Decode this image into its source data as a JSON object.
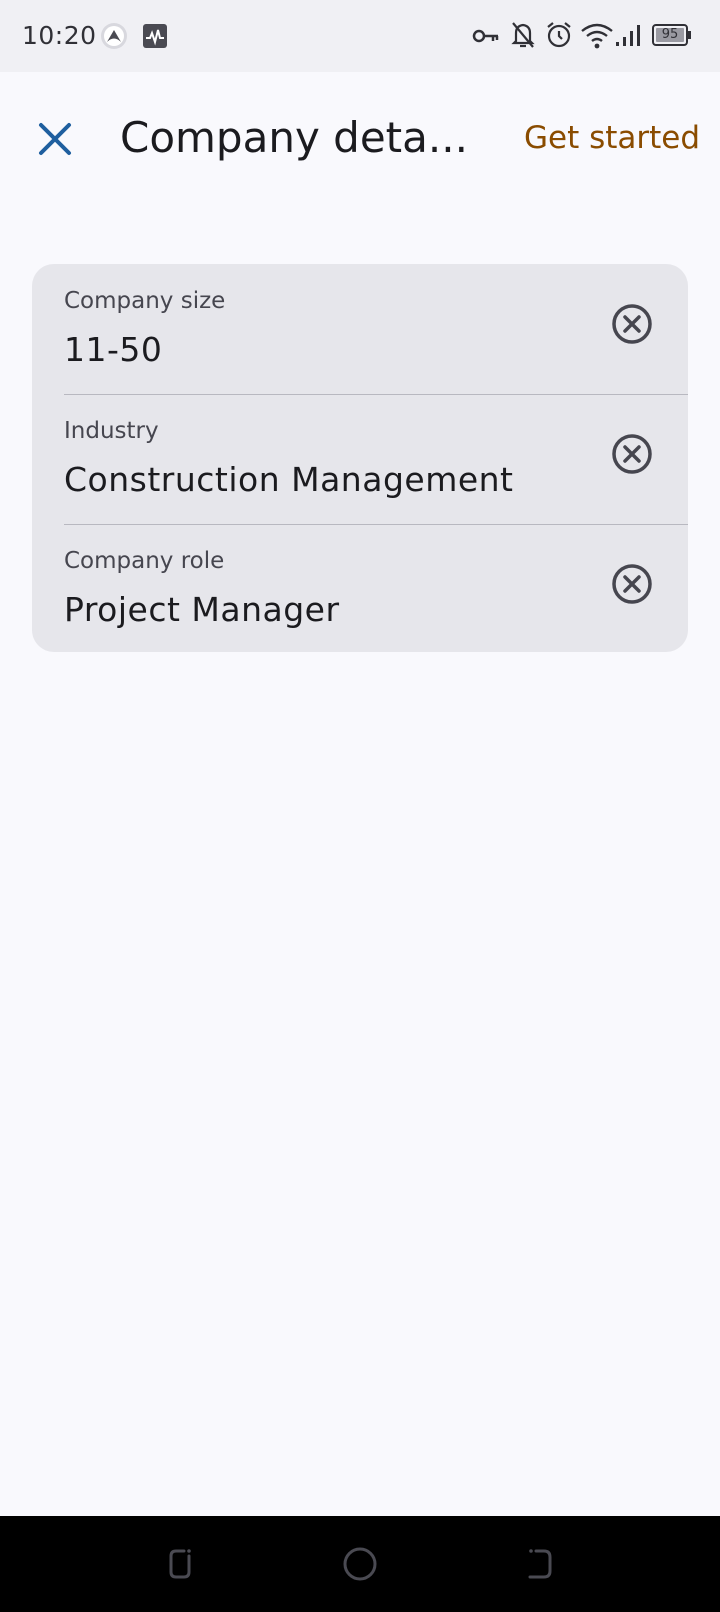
{
  "status_bar": {
    "time": "10:20",
    "battery": "95",
    "icons": [
      "app-notification-icon",
      "activity-monitor-icon",
      "vpn-key-icon",
      "notifications-off-icon",
      "alarm-icon",
      "wifi-icon",
      "signal-icon",
      "battery-icon"
    ]
  },
  "app_bar": {
    "title": "Company deta...",
    "action_label": "Get started",
    "close_icon": "close-icon",
    "accent_color": "#8a4c00",
    "close_color": "#1f5f9f"
  },
  "fields": [
    {
      "label": "Company size",
      "value": "11-50"
    },
    {
      "label": "Industry",
      "value": "Construction Management"
    },
    {
      "label": "Company role",
      "value": "Project Manager"
    }
  ],
  "nav_bar": {
    "buttons": [
      "recent-apps-icon",
      "home-icon",
      "back-icon"
    ]
  }
}
